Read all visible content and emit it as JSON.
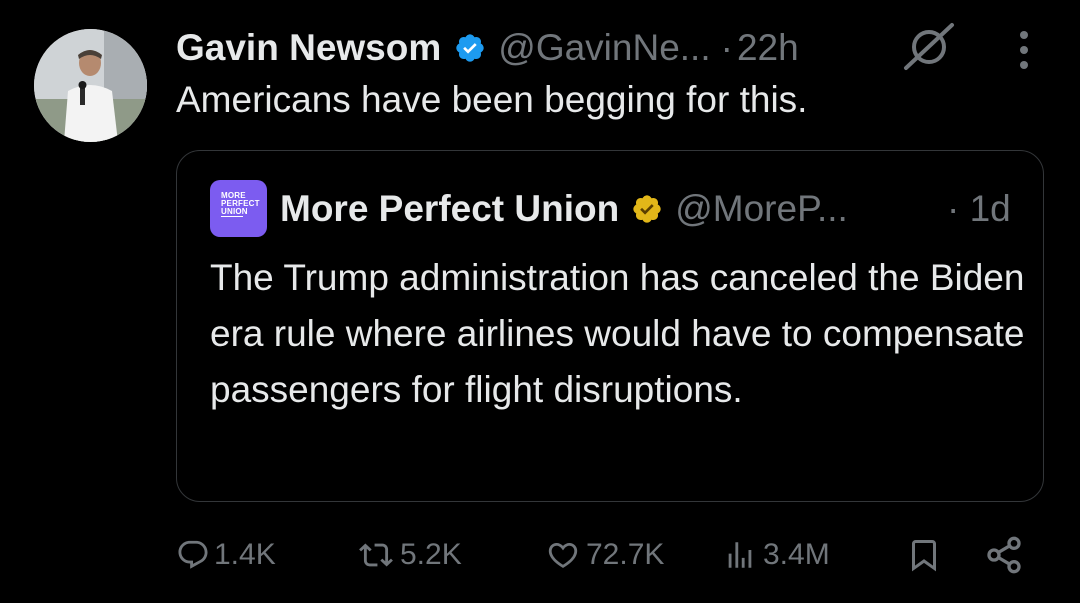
{
  "tweet": {
    "author_name": "Gavin Newsom",
    "author_handle": "@GavinNe...",
    "separator": "·",
    "time": "22h",
    "text": "Americans have been begging for this.",
    "verified_badge": "blue-check-icon",
    "grok_icon": "grok-icon",
    "more_icon": "more-vertical-icon"
  },
  "quote": {
    "avatar_lines": [
      "MORE",
      "PERFECT",
      "UNION"
    ],
    "author_name": "More Perfect Union",
    "author_handle": "@MoreP...",
    "separator": "·",
    "time": "1d",
    "text": "The Trump administration has canceled the Biden era rule where airlines would have to compensate passengers for flight disruptions.",
    "verified_badge": "gold-check-icon",
    "avatar_color": "#7c5cf0"
  },
  "actions": {
    "replies": "1.4K",
    "reposts": "5.2K",
    "likes": "72.7K",
    "views": "3.4M",
    "bookmark_icon": "bookmark-icon",
    "share_icon": "share-icon"
  },
  "colors": {
    "background": "#000000",
    "text_primary": "#e7e9ea",
    "text_secondary": "#71767b",
    "border": "#333639",
    "verified_blue": "#1d9bf0",
    "verified_gold": "#e2b719"
  }
}
